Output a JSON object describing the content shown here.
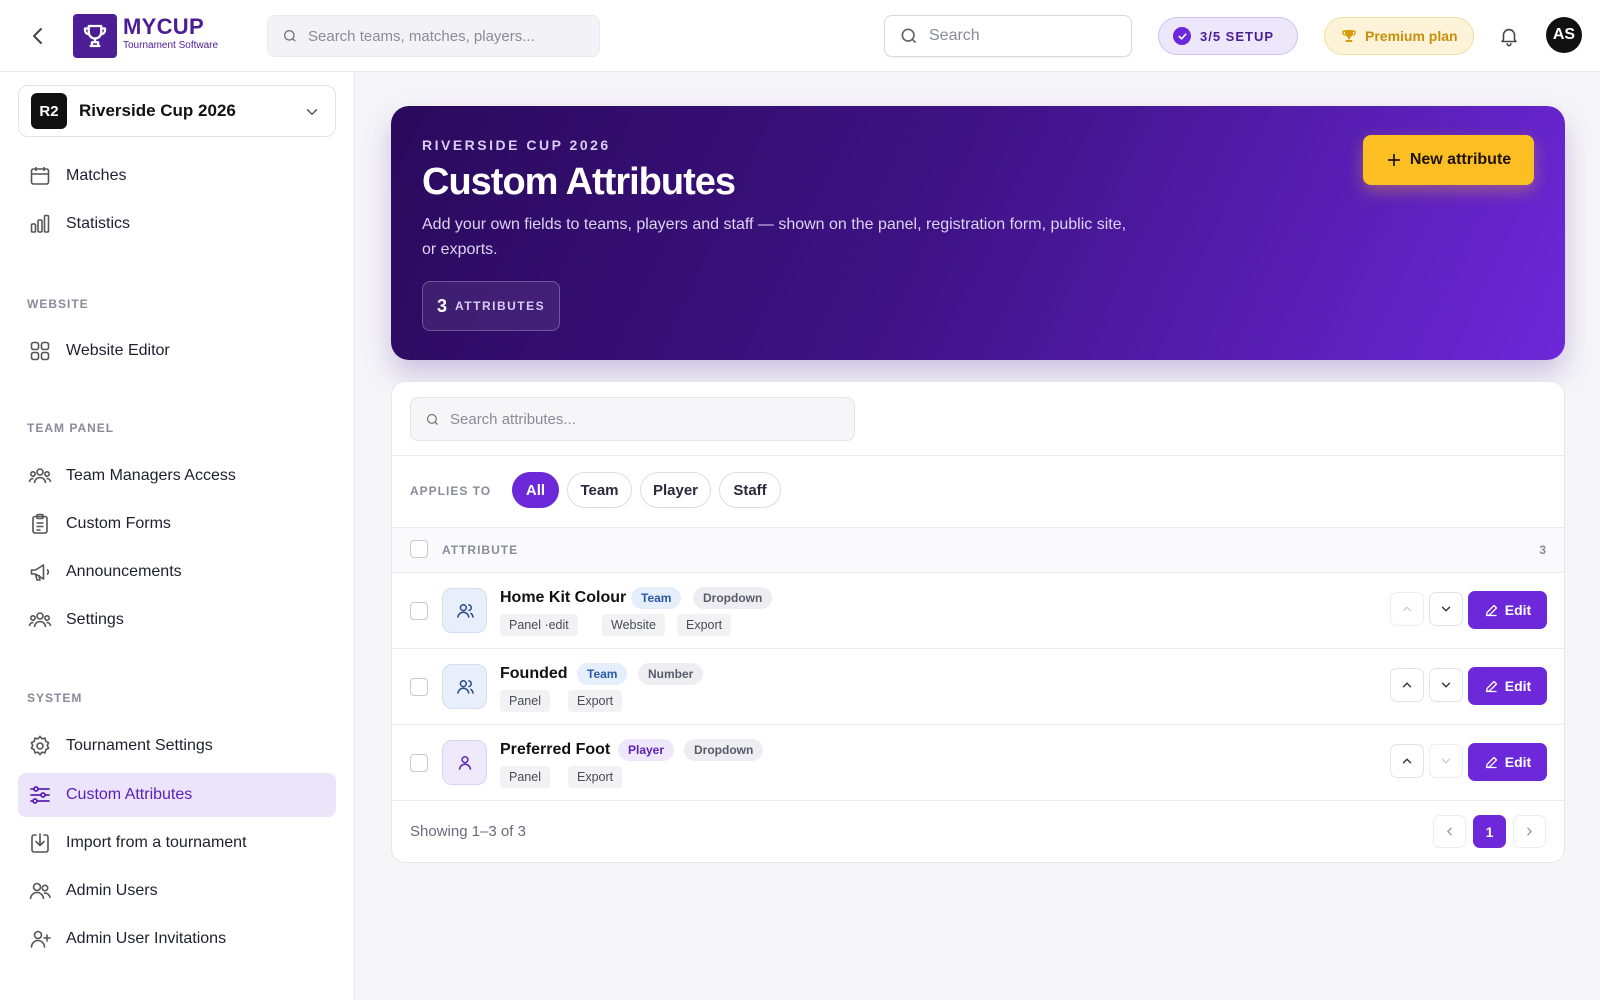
{
  "header": {
    "brand_name": "MYCUP",
    "brand_sub": "Tournament Software",
    "search_placeholder": "Search teams, matches, players...",
    "search2_placeholder": "Search",
    "setup_label": "3/5 SETUP",
    "premium_label": "Premium plan",
    "avatar_initials": "AS",
    "accent_color": "#4c1d95"
  },
  "sidebar": {
    "tournament_badge": "R2",
    "tournament_name": "Riverside Cup 2026",
    "items_top": [
      {
        "label": "Matches",
        "icon": "calendar-icon"
      },
      {
        "label": "Statistics",
        "icon": "bar-chart-icon"
      }
    ],
    "section_website": "WEBSITE",
    "items_website": [
      {
        "label": "Website Editor",
        "icon": "grid-icon"
      }
    ],
    "section_team_panel": "TEAM PANEL",
    "items_team_panel": [
      {
        "label": "Team Managers Access",
        "icon": "users-icon"
      },
      {
        "label": "Custom Forms",
        "icon": "clipboard-icon"
      },
      {
        "label": "Announcements",
        "icon": "megaphone-icon"
      },
      {
        "label": "Settings",
        "icon": "users-gear-icon"
      }
    ],
    "section_system": "SYSTEM",
    "items_system": [
      {
        "label": "Tournament Settings",
        "icon": "gear-icon"
      },
      {
        "label": "Custom Attributes",
        "icon": "sliders-icon",
        "active": true
      },
      {
        "label": "Import from a tournament",
        "icon": "import-icon"
      },
      {
        "label": "Admin Users",
        "icon": "admin-users-icon"
      },
      {
        "label": "Admin User Invitations",
        "icon": "user-plus-icon"
      }
    ]
  },
  "hero": {
    "eyebrow": "RIVERSIDE CUP 2026",
    "title": "Custom Attributes",
    "description": "Add your own fields to teams, players and staff — shown on the panel, registration form, public site, or exports.",
    "count_number": "3",
    "count_unit": "ATTRIBUTES",
    "new_button": "New attribute"
  },
  "panel": {
    "search_placeholder": "Search attributes...",
    "applies_to_label": "APPLIES TO",
    "filters": [
      "All",
      "Team",
      "Player",
      "Staff"
    ],
    "active_filter": "All",
    "column_header": "ATTRIBUTE",
    "total_count": "3",
    "rows": [
      {
        "name": "Home Kit Colour",
        "scope": "Team",
        "type": "Dropdown",
        "visibility": [
          "Panel ·edit",
          "Website",
          "Export"
        ],
        "icon": "team-icon"
      },
      {
        "name": "Founded",
        "scope": "Team",
        "type": "Number",
        "visibility": [
          "Panel",
          "Export"
        ],
        "icon": "team-icon"
      },
      {
        "name": "Preferred Foot",
        "scope": "Player",
        "type": "Dropdown",
        "visibility": [
          "Panel",
          "Export"
        ],
        "icon": "player-icon"
      }
    ],
    "edit_label": "Edit",
    "footer_text": "Showing 1–3 of 3",
    "current_page": "1"
  }
}
